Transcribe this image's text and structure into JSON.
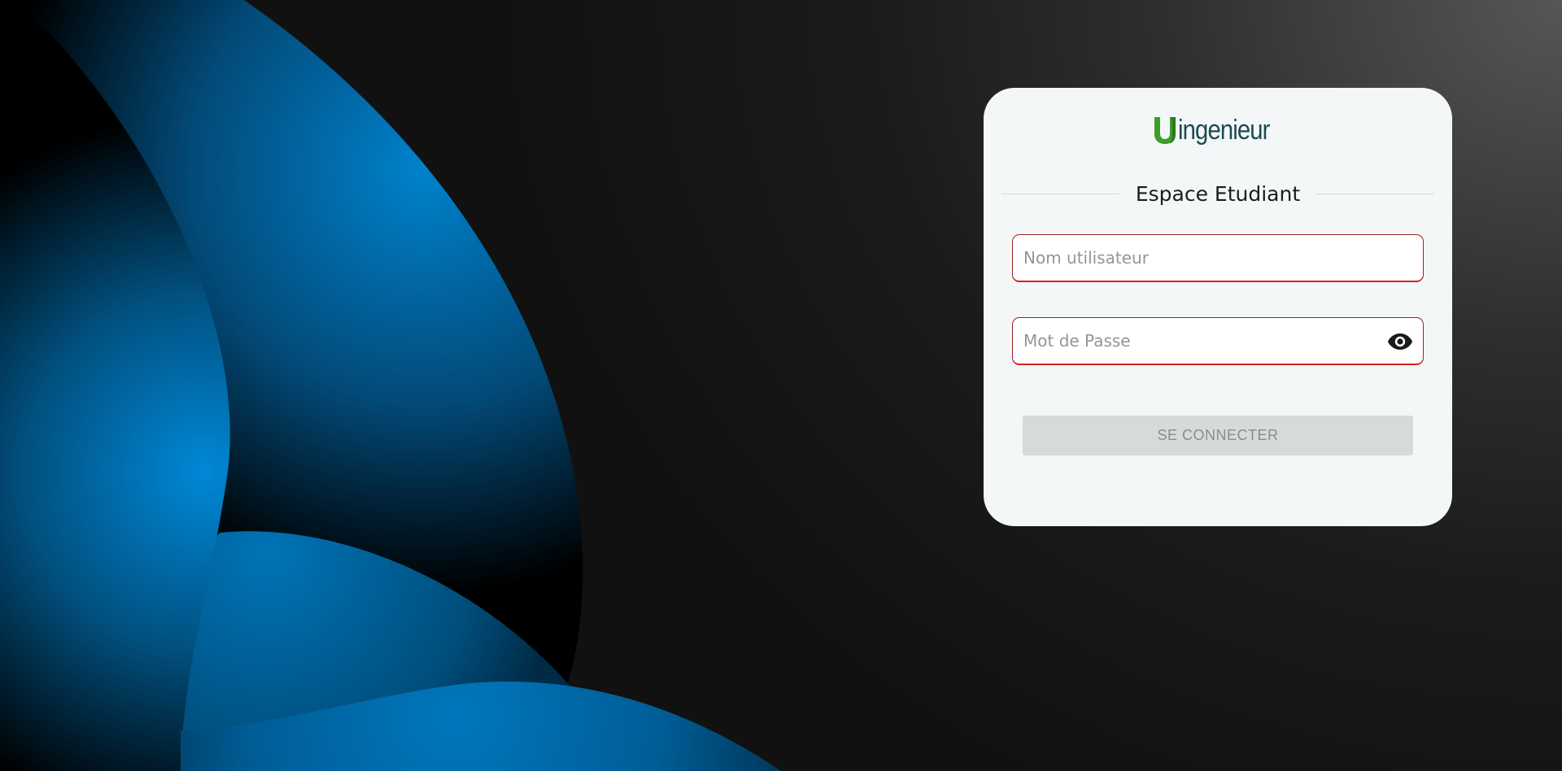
{
  "brand": {
    "logo_mark": "U",
    "logo_text": "ingenieur",
    "logo_green": "#3e9d2b",
    "logo_dark": "#1d4a52"
  },
  "login": {
    "title": "Espace Etudiant",
    "username_placeholder": "Nom utilisateur",
    "password_placeholder": "Mot de Passe",
    "submit_label": "SE CONNECTER",
    "show_password_icon": "eye-icon"
  },
  "colors": {
    "card_bg": "#f4f7f8",
    "field_border": "#dd1f1f",
    "button_disabled_bg": "#d7dadb",
    "accent_blue": "#0082cc"
  }
}
